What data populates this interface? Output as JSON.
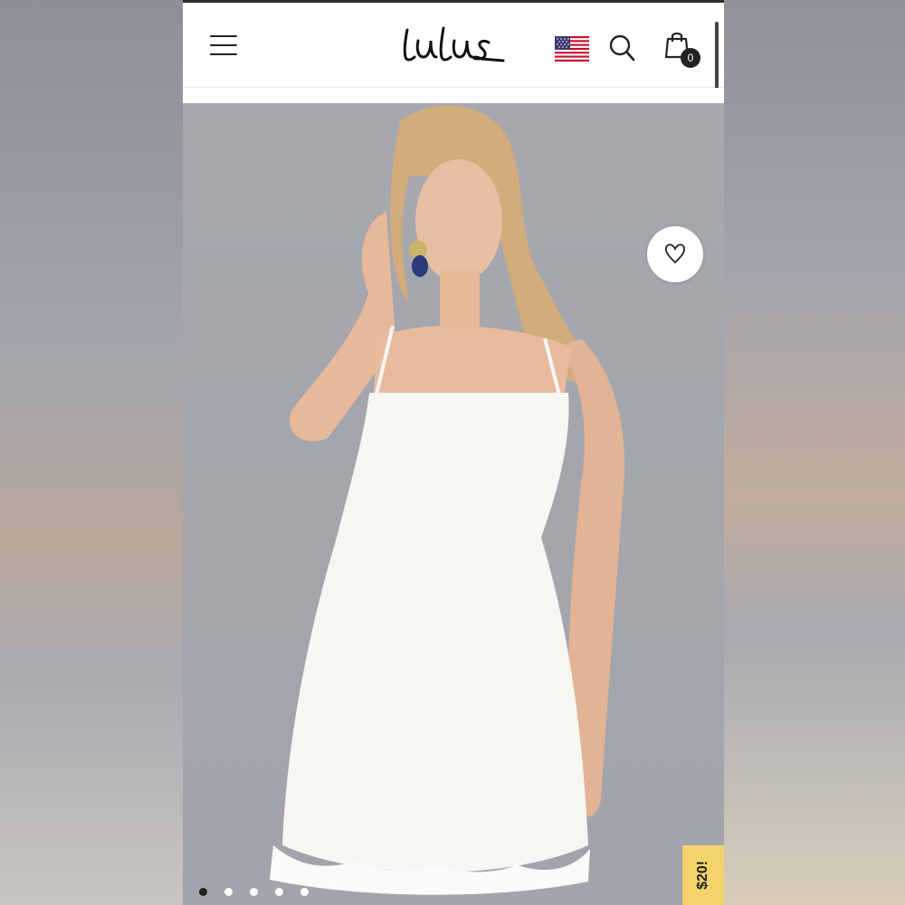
{
  "header": {
    "logo_text": "Lulus",
    "menu_icon": "hamburger-menu-icon",
    "flag_icon": "us-flag-icon",
    "search_icon": "search-icon",
    "bag_icon": "shopping-bag-icon",
    "bag_count": "0"
  },
  "product": {
    "image_description_icon": "product-photo",
    "favorite_icon": "heart-icon",
    "carousel_dots": 5,
    "active_dot": 0,
    "promo_label": "$20!"
  },
  "colors": {
    "header_bg": "#ffffff",
    "image_bg": "#a5a7ae",
    "promo_bg": "#f2d36b",
    "text": "#222222"
  }
}
